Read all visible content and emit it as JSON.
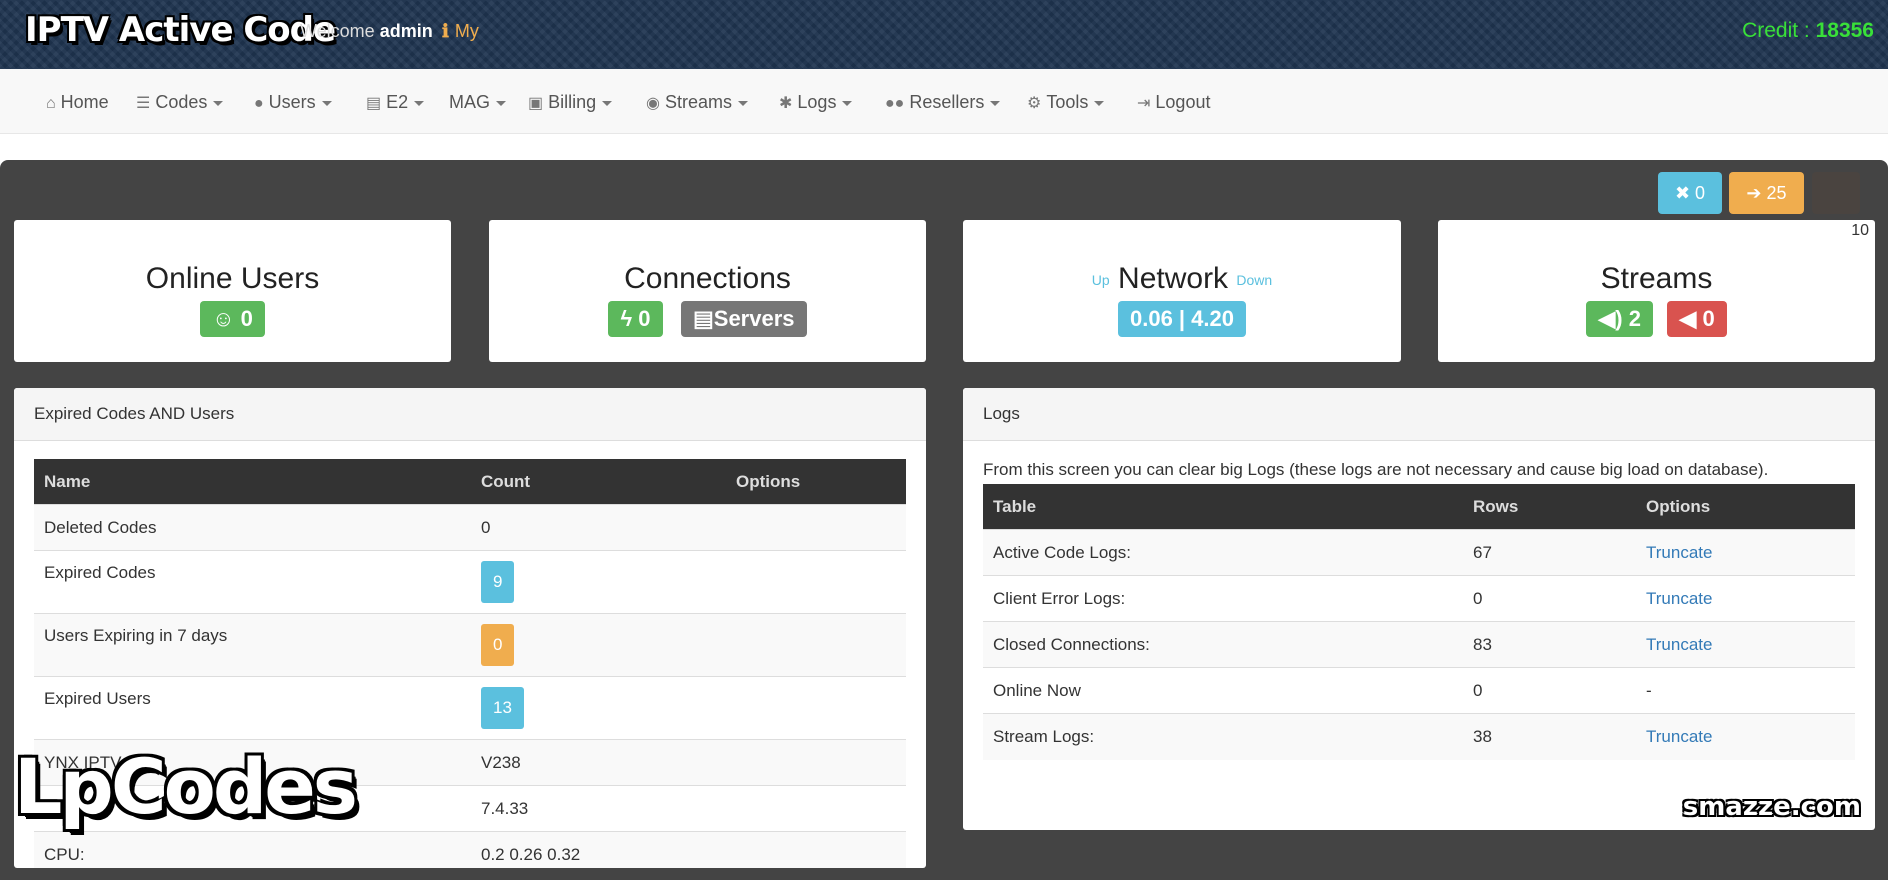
{
  "header": {
    "brand": "IPTV Active Code",
    "welcome_prefix": "Welcome",
    "username": "admin",
    "my_label": "My",
    "credit_label": "Credit :",
    "credit_value": "18356"
  },
  "nav": [
    {
      "label": "Home",
      "icon": "home-icon",
      "dropdown": false
    },
    {
      "label": "Codes",
      "icon": "list-icon",
      "dropdown": true
    },
    {
      "label": "Users",
      "icon": "user-icon",
      "dropdown": true
    },
    {
      "label": "E2",
      "icon": "server-icon",
      "dropdown": true
    },
    {
      "label": "MAG",
      "icon": "",
      "dropdown": true
    },
    {
      "label": "Billing",
      "icon": "money-icon",
      "dropdown": true
    },
    {
      "label": "Streams",
      "icon": "podcast-icon",
      "dropdown": true
    },
    {
      "label": "Logs",
      "icon": "bug-icon",
      "dropdown": true
    },
    {
      "label": "Resellers",
      "icon": "users-icon",
      "dropdown": true
    },
    {
      "label": "Tools",
      "icon": "gear-icon",
      "dropdown": true
    },
    {
      "label": "Logout",
      "icon": "signout-icon",
      "dropdown": false
    }
  ],
  "top_buttons": {
    "blocked": "0",
    "logins": "25",
    "corner_number": "10"
  },
  "stats": {
    "online_users": {
      "title": "Online Users",
      "value": "0"
    },
    "connections": {
      "title": "Connections",
      "value": "0",
      "servers_label": "Servers"
    },
    "network": {
      "title": "Network",
      "up_label": "Up",
      "down_label": "Down",
      "value": "0.06 | 4.20"
    },
    "streams": {
      "title": "Streams",
      "online": "2",
      "offline": "0"
    }
  },
  "expired_panel": {
    "title": "Expired Codes AND Users",
    "columns": [
      "Name",
      "Count",
      "Options"
    ],
    "rows": [
      {
        "name": "Deleted Codes",
        "count": "0",
        "badge": ""
      },
      {
        "name": "Expired Codes",
        "count": "9",
        "badge": "blue"
      },
      {
        "name": "Users Expiring in 7 days",
        "count": "0",
        "badge": "orange"
      },
      {
        "name": "Expired Users",
        "count": "13",
        "badge": "blue"
      },
      {
        "name": "YNX IPTV",
        "count": "V238",
        "badge": ""
      },
      {
        "name": "",
        "count": "7.4.33",
        "badge": ""
      },
      {
        "name": "CPU:",
        "count": "0.2 0.26 0.32",
        "badge": ""
      }
    ]
  },
  "logs_panel": {
    "title": "Logs",
    "description": "From this screen you can clear big Logs (these logs are not necessary and cause big load on database).",
    "columns": [
      "Table",
      "Rows",
      "Options"
    ],
    "rows": [
      {
        "table": "Active Code Logs:",
        "rows": "67",
        "option": "Truncate"
      },
      {
        "table": "Client Error Logs:",
        "rows": "0",
        "option": "Truncate"
      },
      {
        "table": "Closed Connections:",
        "rows": "83",
        "option": "Truncate"
      },
      {
        "table": "Online Now",
        "rows": "0",
        "option": "-"
      },
      {
        "table": "Stream Logs:",
        "rows": "38",
        "option": "Truncate"
      }
    ]
  },
  "watermarks": {
    "left": "LpCodes",
    "right": "smazze.com"
  }
}
